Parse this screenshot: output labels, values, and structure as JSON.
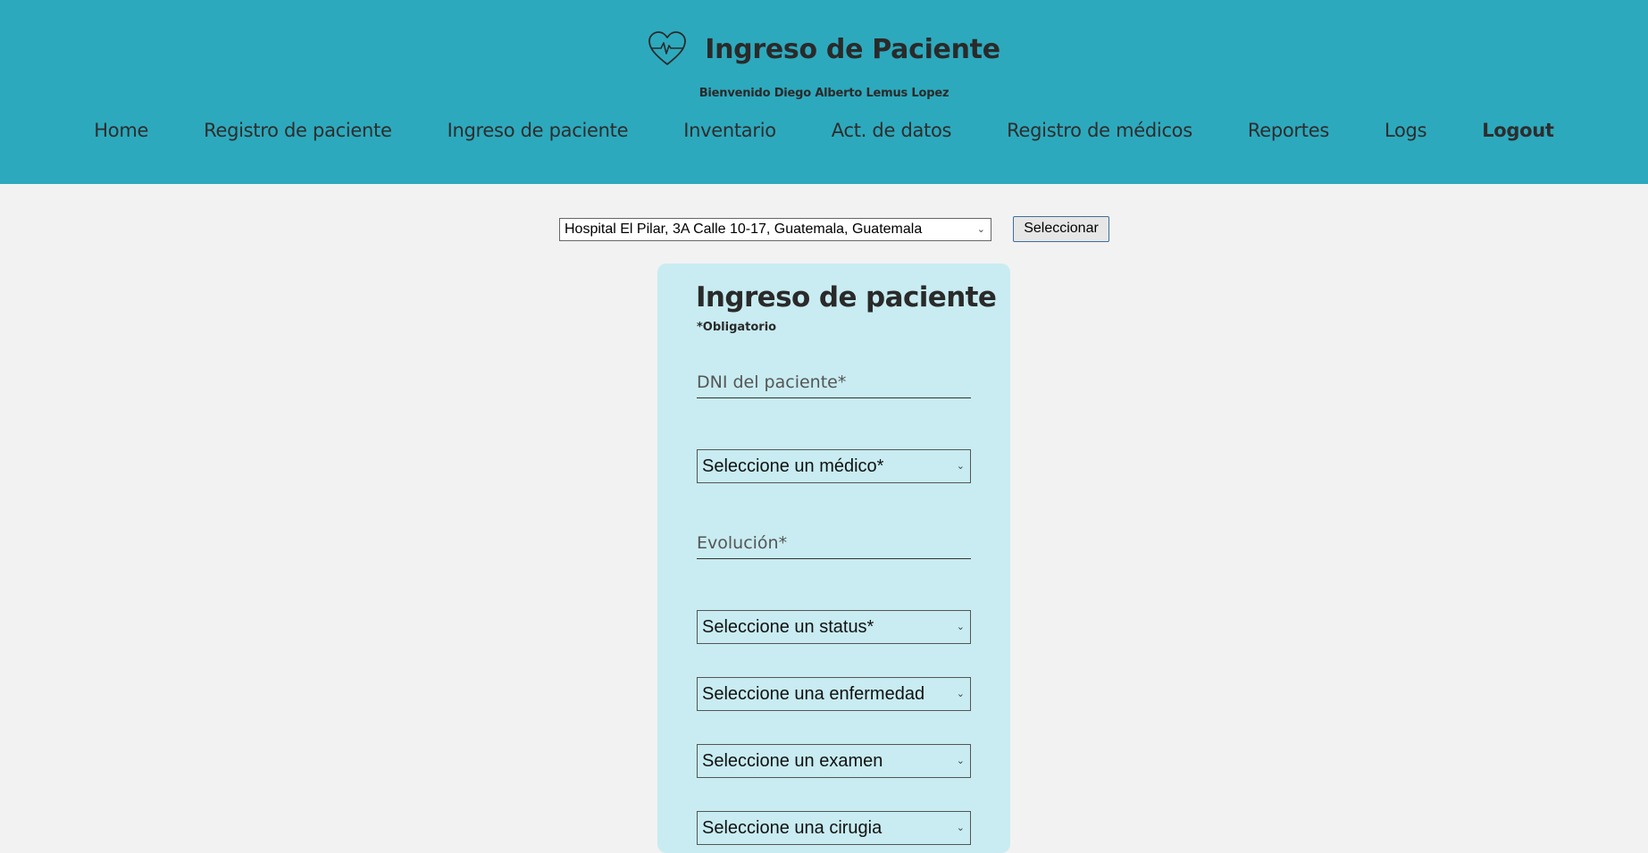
{
  "header": {
    "title": "Ingreso de Paciente",
    "welcome": "Bienvenido Diego Alberto Lemus Lopez",
    "icon": "heart-pulse-icon"
  },
  "nav": {
    "items": [
      {
        "label": "Home"
      },
      {
        "label": "Registro de paciente"
      },
      {
        "label": "Ingreso de paciente"
      },
      {
        "label": "Inventario"
      },
      {
        "label": "Act. de datos"
      },
      {
        "label": "Registro de médicos"
      },
      {
        "label": "Reportes"
      },
      {
        "label": "Logs"
      },
      {
        "label": "Logout"
      }
    ]
  },
  "hospital": {
    "selected": "Hospital El Pilar, 3A Calle 10-17, Guatemala, Guatemala",
    "button": "Seleccionar"
  },
  "form": {
    "title": "Ingreso de paciente",
    "required_note": "*Obligatorio",
    "dni_placeholder": "DNI del paciente*",
    "medico_selected": "Seleccione un médico*",
    "evolucion_placeholder": "Evolución*",
    "status_selected": "Seleccione un status*",
    "enfermedad_selected": "Seleccione una enfermedad",
    "examen_selected": "Seleccione un examen",
    "cirugia_selected": "Seleccione una cirugia"
  },
  "colors": {
    "header_bg": "#2da9bd",
    "card_bg": "#c8ecf1",
    "page_bg": "#f2f2f2"
  }
}
